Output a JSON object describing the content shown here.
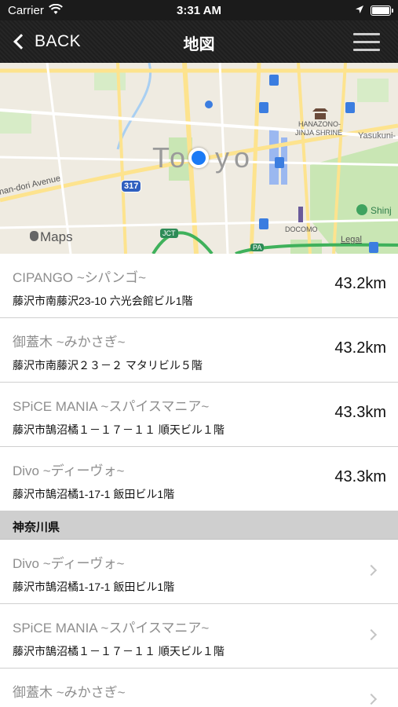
{
  "status_bar": {
    "carrier": "Carrier",
    "time": "3:31 AM",
    "wifi_icon": "wifi-icon",
    "location_icon": "location-arrow-icon",
    "battery_icon": "battery-icon"
  },
  "nav": {
    "back_label": "BACK",
    "title": "地図",
    "menu_icon": "hamburger-menu-icon"
  },
  "map": {
    "city_label_left": "To",
    "city_label_right": "yo",
    "labels": {
      "shrine": "HANAZONO-",
      "shrine2": "JINJA SHRINE",
      "yasukuni": "Yasukuni-",
      "avenue": "han-dori Avenue",
      "route": "317",
      "jct": "JCT",
      "docomo": "DOCOMO",
      "shinjuku": "Shinj",
      "pa": "PA",
      "legal": "Legal",
      "brand": "Maps"
    },
    "colors": {
      "land": "#efebe1",
      "park": "#c9e6b4",
      "water": "#a9cff2",
      "road": "#fde38e",
      "pin": "#1a7af5"
    }
  },
  "shops_nearby": [
    {
      "name": "CIPANGO ~シパンゴ~",
      "address": "藤沢市南藤沢23-10 六光会館ビル1階",
      "distance": "43.2km"
    },
    {
      "name": "御蓋木 ~みかさぎ~",
      "address": "藤沢市南藤沢２３－２ マタリビル５階",
      "distance": "43.2km"
    },
    {
      "name": "SPiCE MANIA ~スパイスマニア~",
      "address": "藤沢市鵠沼橘１－１７－１１ 順天ビル１階",
      "distance": "43.3km"
    },
    {
      "name": "Divo ~ディーヴォ~",
      "address": "藤沢市鵠沼橘1-17-1 飯田ビル1階",
      "distance": "43.3km"
    }
  ],
  "section_header": "神奈川県",
  "shops_prefecture": [
    {
      "name": "Divo ~ディーヴォ~",
      "address": "藤沢市鵠沼橘1-17-1 飯田ビル1階"
    },
    {
      "name": "SPiCE MANIA ~スパイスマニア~",
      "address": "藤沢市鵠沼橘１－１７－１１ 順天ビル１階"
    },
    {
      "name": "御蓋木 ~みかさぎ~",
      "address": ""
    }
  ]
}
